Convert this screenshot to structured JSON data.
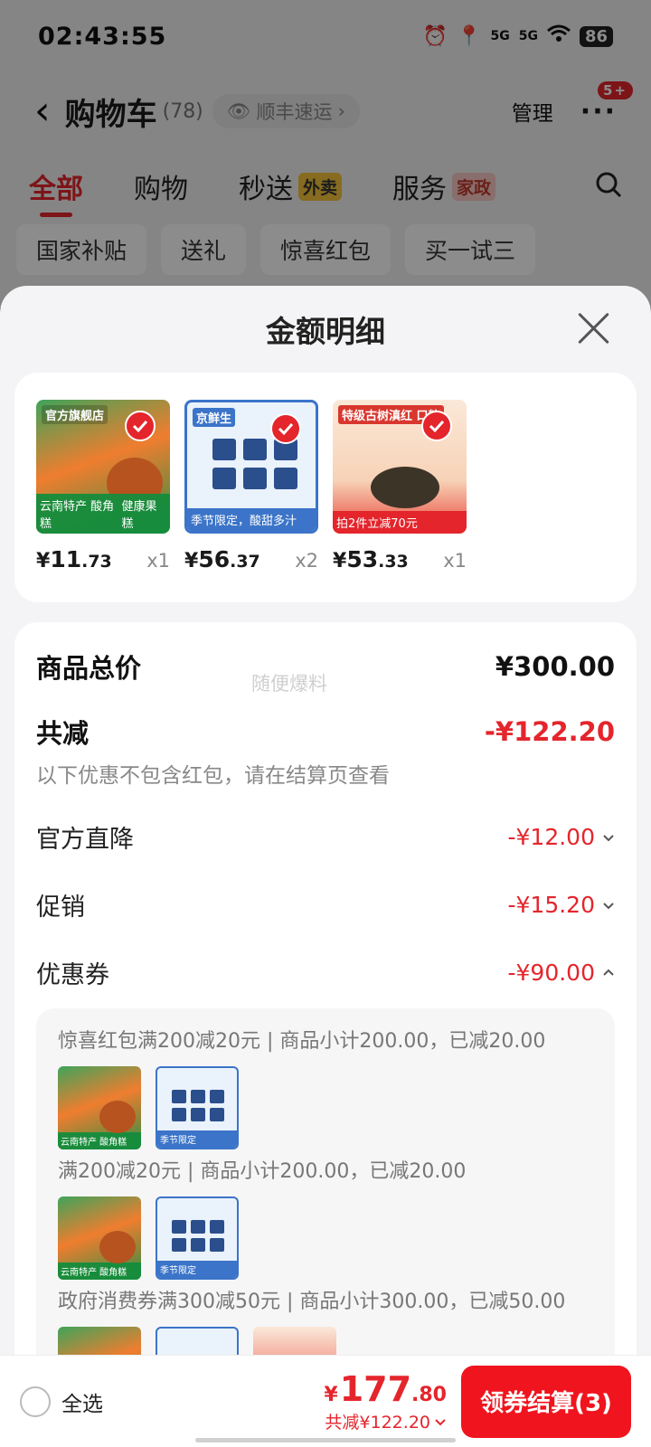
{
  "status_bar": {
    "time": "02:43:55",
    "battery": "86",
    "signal_a": "5G",
    "signal_b": "5G"
  },
  "nav": {
    "title": "购物车",
    "count": "(78)",
    "shipping_pill": "顺丰速运",
    "manage": "管理",
    "badge": "5+"
  },
  "tabs": [
    {
      "label": "全部"
    },
    {
      "label": "购物"
    },
    {
      "label": "秒送",
      "badge": "外卖"
    },
    {
      "label": "服务",
      "badge": "家政"
    }
  ],
  "chips": [
    "国家补贴",
    "送礼",
    "惊喜红包",
    "买一试三"
  ],
  "sheet": {
    "title": "金额明细",
    "products": [
      {
        "yen": "¥",
        "price_int": "11",
        "price_dec": ".73",
        "qty": "x1",
        "img_top": "官方旗舰店",
        "img_label_left": "云南特产 酸角糕",
        "img_label_right": "健康果糕"
      },
      {
        "yen": "¥",
        "price_int": "56",
        "price_dec": ".37",
        "qty": "x2",
        "img_top": "京鲜生",
        "img_label_left": "季节限定，酸甜多汁",
        "img_label_right": ""
      },
      {
        "yen": "¥",
        "price_int": "53",
        "price_dec": ".33",
        "qty": "x1",
        "img_top": "特级古树滇红 口粮",
        "img_label_left": "拍2件立减70元",
        "img_label_right": ""
      }
    ],
    "details": {
      "total_label": "商品总价",
      "total_value": "¥300.00",
      "watermark": "随便爆料",
      "discount_label": "共减",
      "discount_value": "-¥122.20",
      "discount_note": "以下优惠不包含红包，请在结算页查看",
      "official_label": "官方直降",
      "official_value": "-¥12.00",
      "promo_label": "促销",
      "promo_value": "-¥15.20",
      "coupon_label": "优惠券",
      "coupon_value": "-¥90.00"
    },
    "coupons": [
      {
        "text": "惊喜红包满200减20元 | 商品小计200.00，已减20.00"
      },
      {
        "text": "满200减20元 | 商品小计200.00，已减20.00"
      },
      {
        "text": "政府消费券满300减50元 | 商品小计300.00，已减50.00"
      }
    ],
    "thumb_tags": {
      "t1": "云南特产 酸角糕",
      "t2": "季节限定"
    }
  },
  "bottom_bar": {
    "select_all": "全选",
    "yen": "¥",
    "total_int": "177",
    "total_dec": ".80",
    "savings": "共减¥122.20",
    "checkout": "领券结算(3)"
  },
  "colors": {
    "accent": "#e4252c",
    "button": "#f0141e"
  },
  "icons": [
    "back-arrow-icon",
    "eye-icon",
    "chevron-right-icon",
    "more-dots-icon",
    "search-icon",
    "close-icon",
    "check-icon",
    "chevron-down-icon",
    "chevron-up-icon",
    "alarm-icon",
    "location-icon",
    "wifi-icon"
  ]
}
